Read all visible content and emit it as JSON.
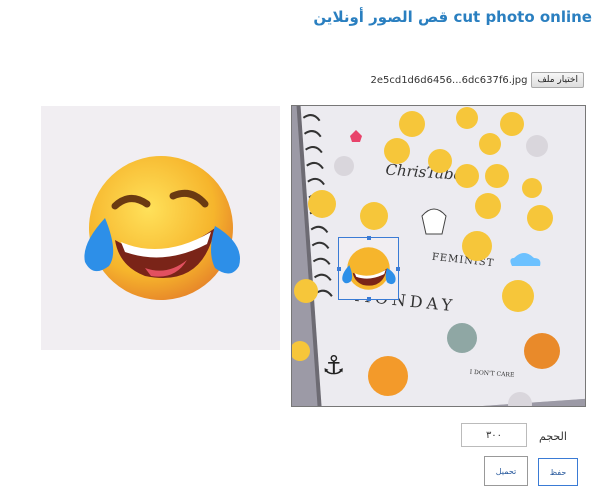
{
  "header": {
    "title": "cut photo online قص الصور أونلاين"
  },
  "file": {
    "button_label": "اختيار ملف",
    "filename": "2e5cd1d6d6456...6dc637f6.jpg"
  },
  "notebook": {
    "brand_text": "ChrisTabel",
    "feminist_text": "FEMINIST",
    "monday_text": "MONDAY",
    "dont_care_text": "I DON'T CARE"
  },
  "controls": {
    "size_label": "الحجم",
    "size_value": "٣٠٠",
    "save_label": "حفظ",
    "download_label": "تحميل"
  },
  "colors": {
    "title": "#2a7fc0",
    "crop_border": "#3a7bd5"
  }
}
